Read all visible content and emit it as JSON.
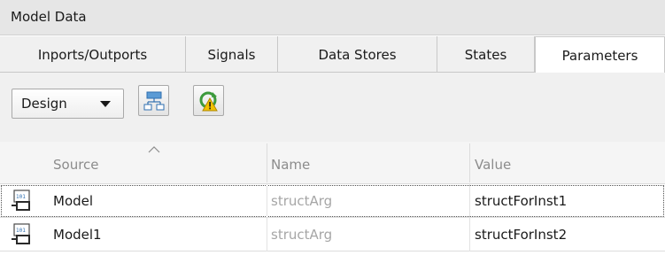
{
  "window": {
    "title": "Model Data"
  },
  "tabs": [
    {
      "label": "Inports/Outports"
    },
    {
      "label": "Signals"
    },
    {
      "label": "Data Stores"
    },
    {
      "label": "States"
    },
    {
      "label": "Parameters"
    }
  ],
  "active_tab": "Parameters",
  "toolbar": {
    "view_select": "Design",
    "hierarchy_button_icon": "hierarchy-icon",
    "refresh_button_icon": "refresh-warning-icon"
  },
  "table": {
    "columns": [
      "Source",
      "Name",
      "Value"
    ],
    "sorted_column": "Source",
    "rows": [
      {
        "source": "Model",
        "name": "structArg",
        "value": "structForInst1"
      },
      {
        "source": "Model1",
        "name": "structArg",
        "value": "structForInst2"
      }
    ]
  }
}
